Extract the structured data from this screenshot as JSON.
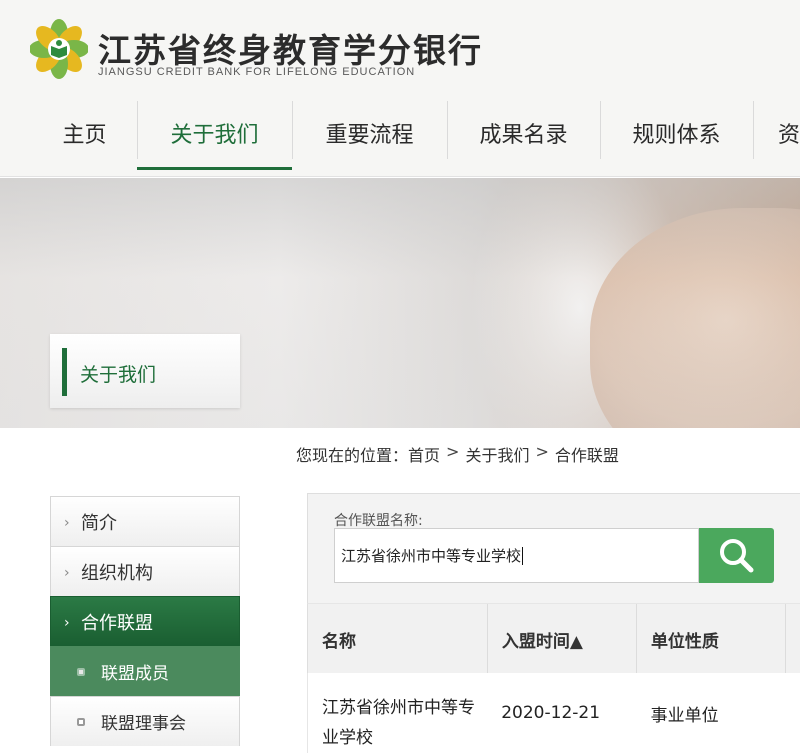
{
  "site": {
    "title": "江苏省终身教育学分银行",
    "subtitle": "JIANGSU CREDIT BANK FOR LIFELONG  EDUCATION"
  },
  "nav": {
    "items": [
      {
        "label": "主页"
      },
      {
        "label": "关于我们"
      },
      {
        "label": "重要流程"
      },
      {
        "label": "成果名录"
      },
      {
        "label": "规则体系"
      },
      {
        "label": "资"
      }
    ],
    "active_index": 1
  },
  "banner": {
    "label": "关于我们"
  },
  "breadcrumb": {
    "prefix": "您现在的位置：",
    "items": [
      "首页",
      "关于我们",
      "合作联盟"
    ],
    "separator": ">"
  },
  "sidebar": {
    "items": [
      {
        "label": "简介"
      },
      {
        "label": "组织机构"
      },
      {
        "label": "合作联盟"
      }
    ],
    "subitems": [
      {
        "label": "联盟成员"
      },
      {
        "label": "联盟理事会"
      }
    ]
  },
  "search": {
    "label": "合作联盟名称:",
    "value": "江苏省徐州市中等专业学校",
    "button_icon": "search-icon"
  },
  "table": {
    "headers": [
      "名称",
      "入盟时间▲",
      "单位性质",
      ""
    ],
    "rows": [
      [
        "江苏省徐州市中等专业学校",
        "2020-12-21",
        "事业单位",
        ""
      ]
    ]
  },
  "colors": {
    "brand_green": "#1f6e3a",
    "button_green": "#4ba85d",
    "sub_active": "#4b8a5d"
  }
}
